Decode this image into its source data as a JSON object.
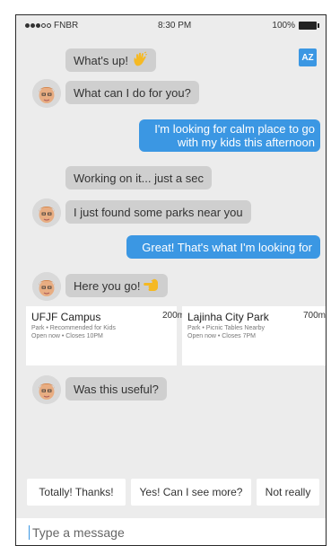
{
  "status_bar": {
    "carrier": "FNBR",
    "signal_bars_filled": 3,
    "time": "8:30 PM",
    "battery": "100%"
  },
  "header": {
    "sort_button_label": "AZ"
  },
  "colors": {
    "accent": "#3b97e3",
    "bot_bubble": "#cfcfcf",
    "background": "#ececec"
  },
  "messages": [
    {
      "from": "bot",
      "text": "What's up!",
      "icon": "waving-hand-icon"
    },
    {
      "from": "bot",
      "text": "What can I do for you?"
    },
    {
      "from": "user",
      "text": "I'm looking for calm place to go with my kids this afternoon"
    },
    {
      "from": "bot",
      "text": "Working on it... just a sec"
    },
    {
      "from": "bot",
      "text": "I just found some parks near you"
    },
    {
      "from": "user",
      "text": "Great! That's what I'm looking for"
    },
    {
      "from": "bot",
      "text": "Here you go!",
      "icon": "pointing-hand-icon"
    },
    {
      "from": "bot",
      "text": "Was this useful?"
    }
  ],
  "places": [
    {
      "name": "UFJF Campus",
      "distance": "200m",
      "details": "Park • Recommended for Kids",
      "hours": "Open now • Closes 10PM"
    },
    {
      "name": "Lajinha City Park",
      "distance": "700m",
      "details": "Park • Picnic Tables Nearby",
      "hours": "Open now • Closes 7PM"
    }
  ],
  "quick_replies": [
    "Totally! Thanks!",
    "Yes! Can I see more?",
    "Not really"
  ],
  "composer": {
    "placeholder": "Type a message"
  }
}
